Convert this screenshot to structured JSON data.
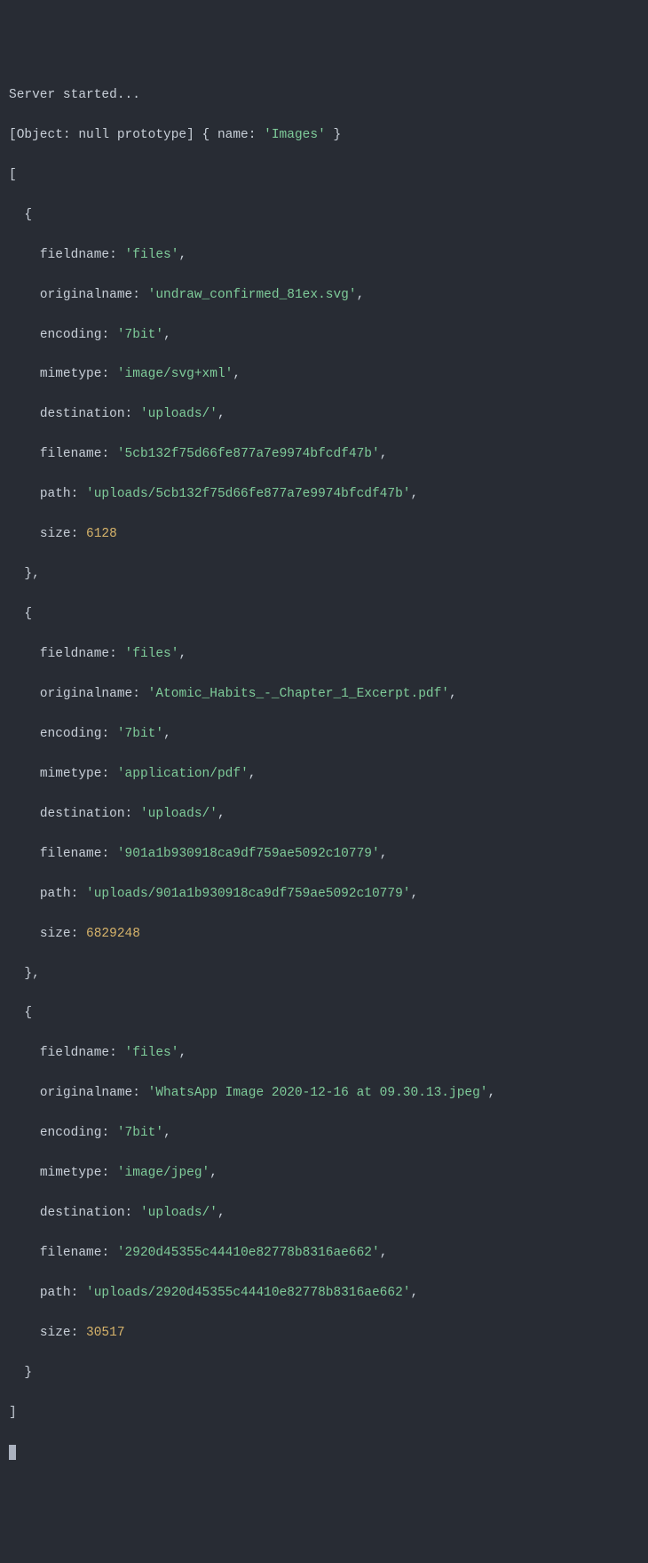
{
  "header": {
    "server_started": "Server started...",
    "object_prefix": "[Object: null prototype] { name: ",
    "object_name": "'Images'",
    "object_suffix": " }"
  },
  "tokens": {
    "open_bracket": "[",
    "close_bracket": "]",
    "open_brace": "  {",
    "close_brace_comma": "  },",
    "close_brace": "  }",
    "indent": "    ",
    "colon_space": ": ",
    "comma": ",",
    "label_fieldname": "fieldname",
    "label_originalname": "originalname",
    "label_encoding": "encoding",
    "label_mimetype": "mimetype",
    "label_destination": "destination",
    "label_filename": "filename",
    "label_path": "path",
    "label_size": "size"
  },
  "entries": [
    {
      "fieldname": "'files'",
      "originalname": "'undraw_confirmed_81ex.svg'",
      "encoding": "'7bit'",
      "mimetype": "'image/svg+xml'",
      "destination": "'uploads/'",
      "filename": "'5cb132f75d66fe877a7e9974bfcdf47b'",
      "path": "'uploads/5cb132f75d66fe877a7e9974bfcdf47b'",
      "size": "6128"
    },
    {
      "fieldname": "'files'",
      "originalname": "'Atomic_Habits_-_Chapter_1_Excerpt.pdf'",
      "encoding": "'7bit'",
      "mimetype": "'application/pdf'",
      "destination": "'uploads/'",
      "filename": "'901a1b930918ca9df759ae5092c10779'",
      "path": "'uploads/901a1b930918ca9df759ae5092c10779'",
      "size": "6829248"
    },
    {
      "fieldname": "'files'",
      "originalname": "'WhatsApp Image 2020-12-16 at 09.30.13.jpeg'",
      "encoding": "'7bit'",
      "mimetype": "'image/jpeg'",
      "destination": "'uploads/'",
      "filename": "'2920d45355c44410e82778b8316ae662'",
      "path": "'uploads/2920d45355c44410e82778b8316ae662'",
      "size": "30517"
    }
  ]
}
